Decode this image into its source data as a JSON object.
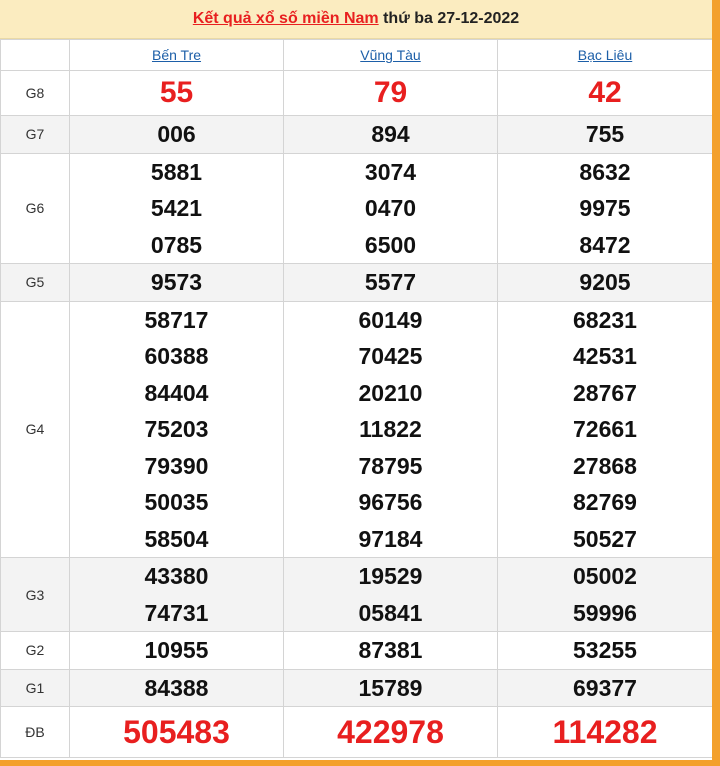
{
  "header": {
    "title_link": "Kết quả xổ số miền Nam",
    "title_rest": " thứ ba 27-12-2022"
  },
  "provinces": [
    "Bến Tre",
    "Vũng Tàu",
    "Bạc Liêu"
  ],
  "prizes": [
    {
      "label": "G8",
      "values": [
        [
          "55"
        ],
        [
          "79"
        ],
        [
          "42"
        ]
      ]
    },
    {
      "label": "G7",
      "values": [
        [
          "006"
        ],
        [
          "894"
        ],
        [
          "755"
        ]
      ]
    },
    {
      "label": "G6",
      "values": [
        [
          "5881",
          "5421",
          "0785"
        ],
        [
          "3074",
          "0470",
          "6500"
        ],
        [
          "8632",
          "9975",
          "8472"
        ]
      ]
    },
    {
      "label": "G5",
      "values": [
        [
          "9573"
        ],
        [
          "5577"
        ],
        [
          "9205"
        ]
      ]
    },
    {
      "label": "G4",
      "values": [
        [
          "58717",
          "60388",
          "84404",
          "75203",
          "79390",
          "50035",
          "58504"
        ],
        [
          "60149",
          "70425",
          "20210",
          "11822",
          "78795",
          "96756",
          "97184"
        ],
        [
          "68231",
          "42531",
          "28767",
          "72661",
          "27868",
          "82769",
          "50527"
        ]
      ]
    },
    {
      "label": "G3",
      "values": [
        [
          "43380",
          "74731"
        ],
        [
          "19529",
          "05841"
        ],
        [
          "05002",
          "59996"
        ]
      ]
    },
    {
      "label": "G2",
      "values": [
        [
          "10955"
        ],
        [
          "87381"
        ],
        [
          "53255"
        ]
      ]
    },
    {
      "label": "G1",
      "values": [
        [
          "84388"
        ],
        [
          "15789"
        ],
        [
          "69377"
        ]
      ]
    },
    {
      "label": "ĐB",
      "values": [
        [
          "505483"
        ],
        [
          "422978"
        ],
        [
          "114282"
        ]
      ]
    }
  ],
  "colors": {
    "accent_red": "#e81f1f",
    "header_bg": "#fbecc0",
    "border_orange": "#f3a02c",
    "link_blue": "#1d5fa8"
  }
}
